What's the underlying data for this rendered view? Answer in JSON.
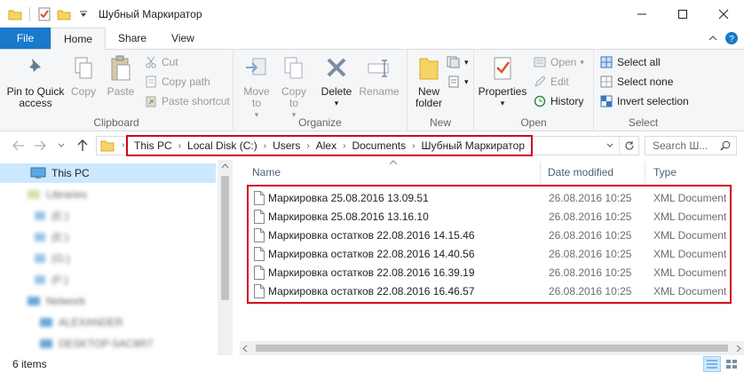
{
  "window": {
    "title": "Шубный Маркиратор",
    "controls": [
      "minimize-icon",
      "maximize-icon",
      "close-icon"
    ]
  },
  "menu": {
    "tabs": [
      "File",
      "Home",
      "Share",
      "View"
    ],
    "active": "Home"
  },
  "ribbon": {
    "clipboard": {
      "label": "Clipboard",
      "pin": "Pin to Quick access",
      "copy": "Copy",
      "paste": "Paste",
      "cut": "Cut",
      "copy_path": "Copy path",
      "paste_shortcut": "Paste shortcut"
    },
    "organize": {
      "label": "Organize",
      "move_to": "Move to",
      "copy_to": "Copy to",
      "delete": "Delete",
      "rename": "Rename"
    },
    "new": {
      "label": "New",
      "new_folder": "New folder"
    },
    "open": {
      "label": "Open",
      "properties": "Properties",
      "open": "Open",
      "edit": "Edit",
      "history": "History"
    },
    "select": {
      "label": "Select",
      "select_all": "Select all",
      "select_none": "Select none",
      "invert": "Invert selection"
    }
  },
  "address": {
    "crumbs": [
      "This PC",
      "Local Disk (C:)",
      "Users",
      "Alex",
      "Documents",
      "Шубный Маркиратор"
    ]
  },
  "search": {
    "placeholder": "Search Ш..."
  },
  "nav_pane": {
    "this_pc": "This PC"
  },
  "file_list": {
    "columns": {
      "name": "Name",
      "date": "Date modified",
      "type": "Type"
    },
    "files": [
      {
        "name": "Маркировка 25.08.2016 13.09.51",
        "date": "26.08.2016 10:25",
        "type": "XML Document"
      },
      {
        "name": "Маркировка 25.08.2016 13.16.10",
        "date": "26.08.2016 10:25",
        "type": "XML Document"
      },
      {
        "name": "Маркировка остатков 22.08.2016 14.15.46",
        "date": "26.08.2016 10:25",
        "type": "XML Document"
      },
      {
        "name": "Маркировка остатков 22.08.2016 14.40.56",
        "date": "26.08.2016 10:25",
        "type": "XML Document"
      },
      {
        "name": "Маркировка остатков 22.08.2016 16.39.19",
        "date": "26.08.2016 10:25",
        "type": "XML Document"
      },
      {
        "name": "Маркировка остатков 22.08.2016 16.46.57",
        "date": "26.08.2016 10:25",
        "type": "XML Document"
      }
    ]
  },
  "status": {
    "items": "6 items"
  },
  "colors": {
    "file_tab": "#1979ca",
    "highlight_box": "#d0021b",
    "selection": "#cce8ff"
  }
}
